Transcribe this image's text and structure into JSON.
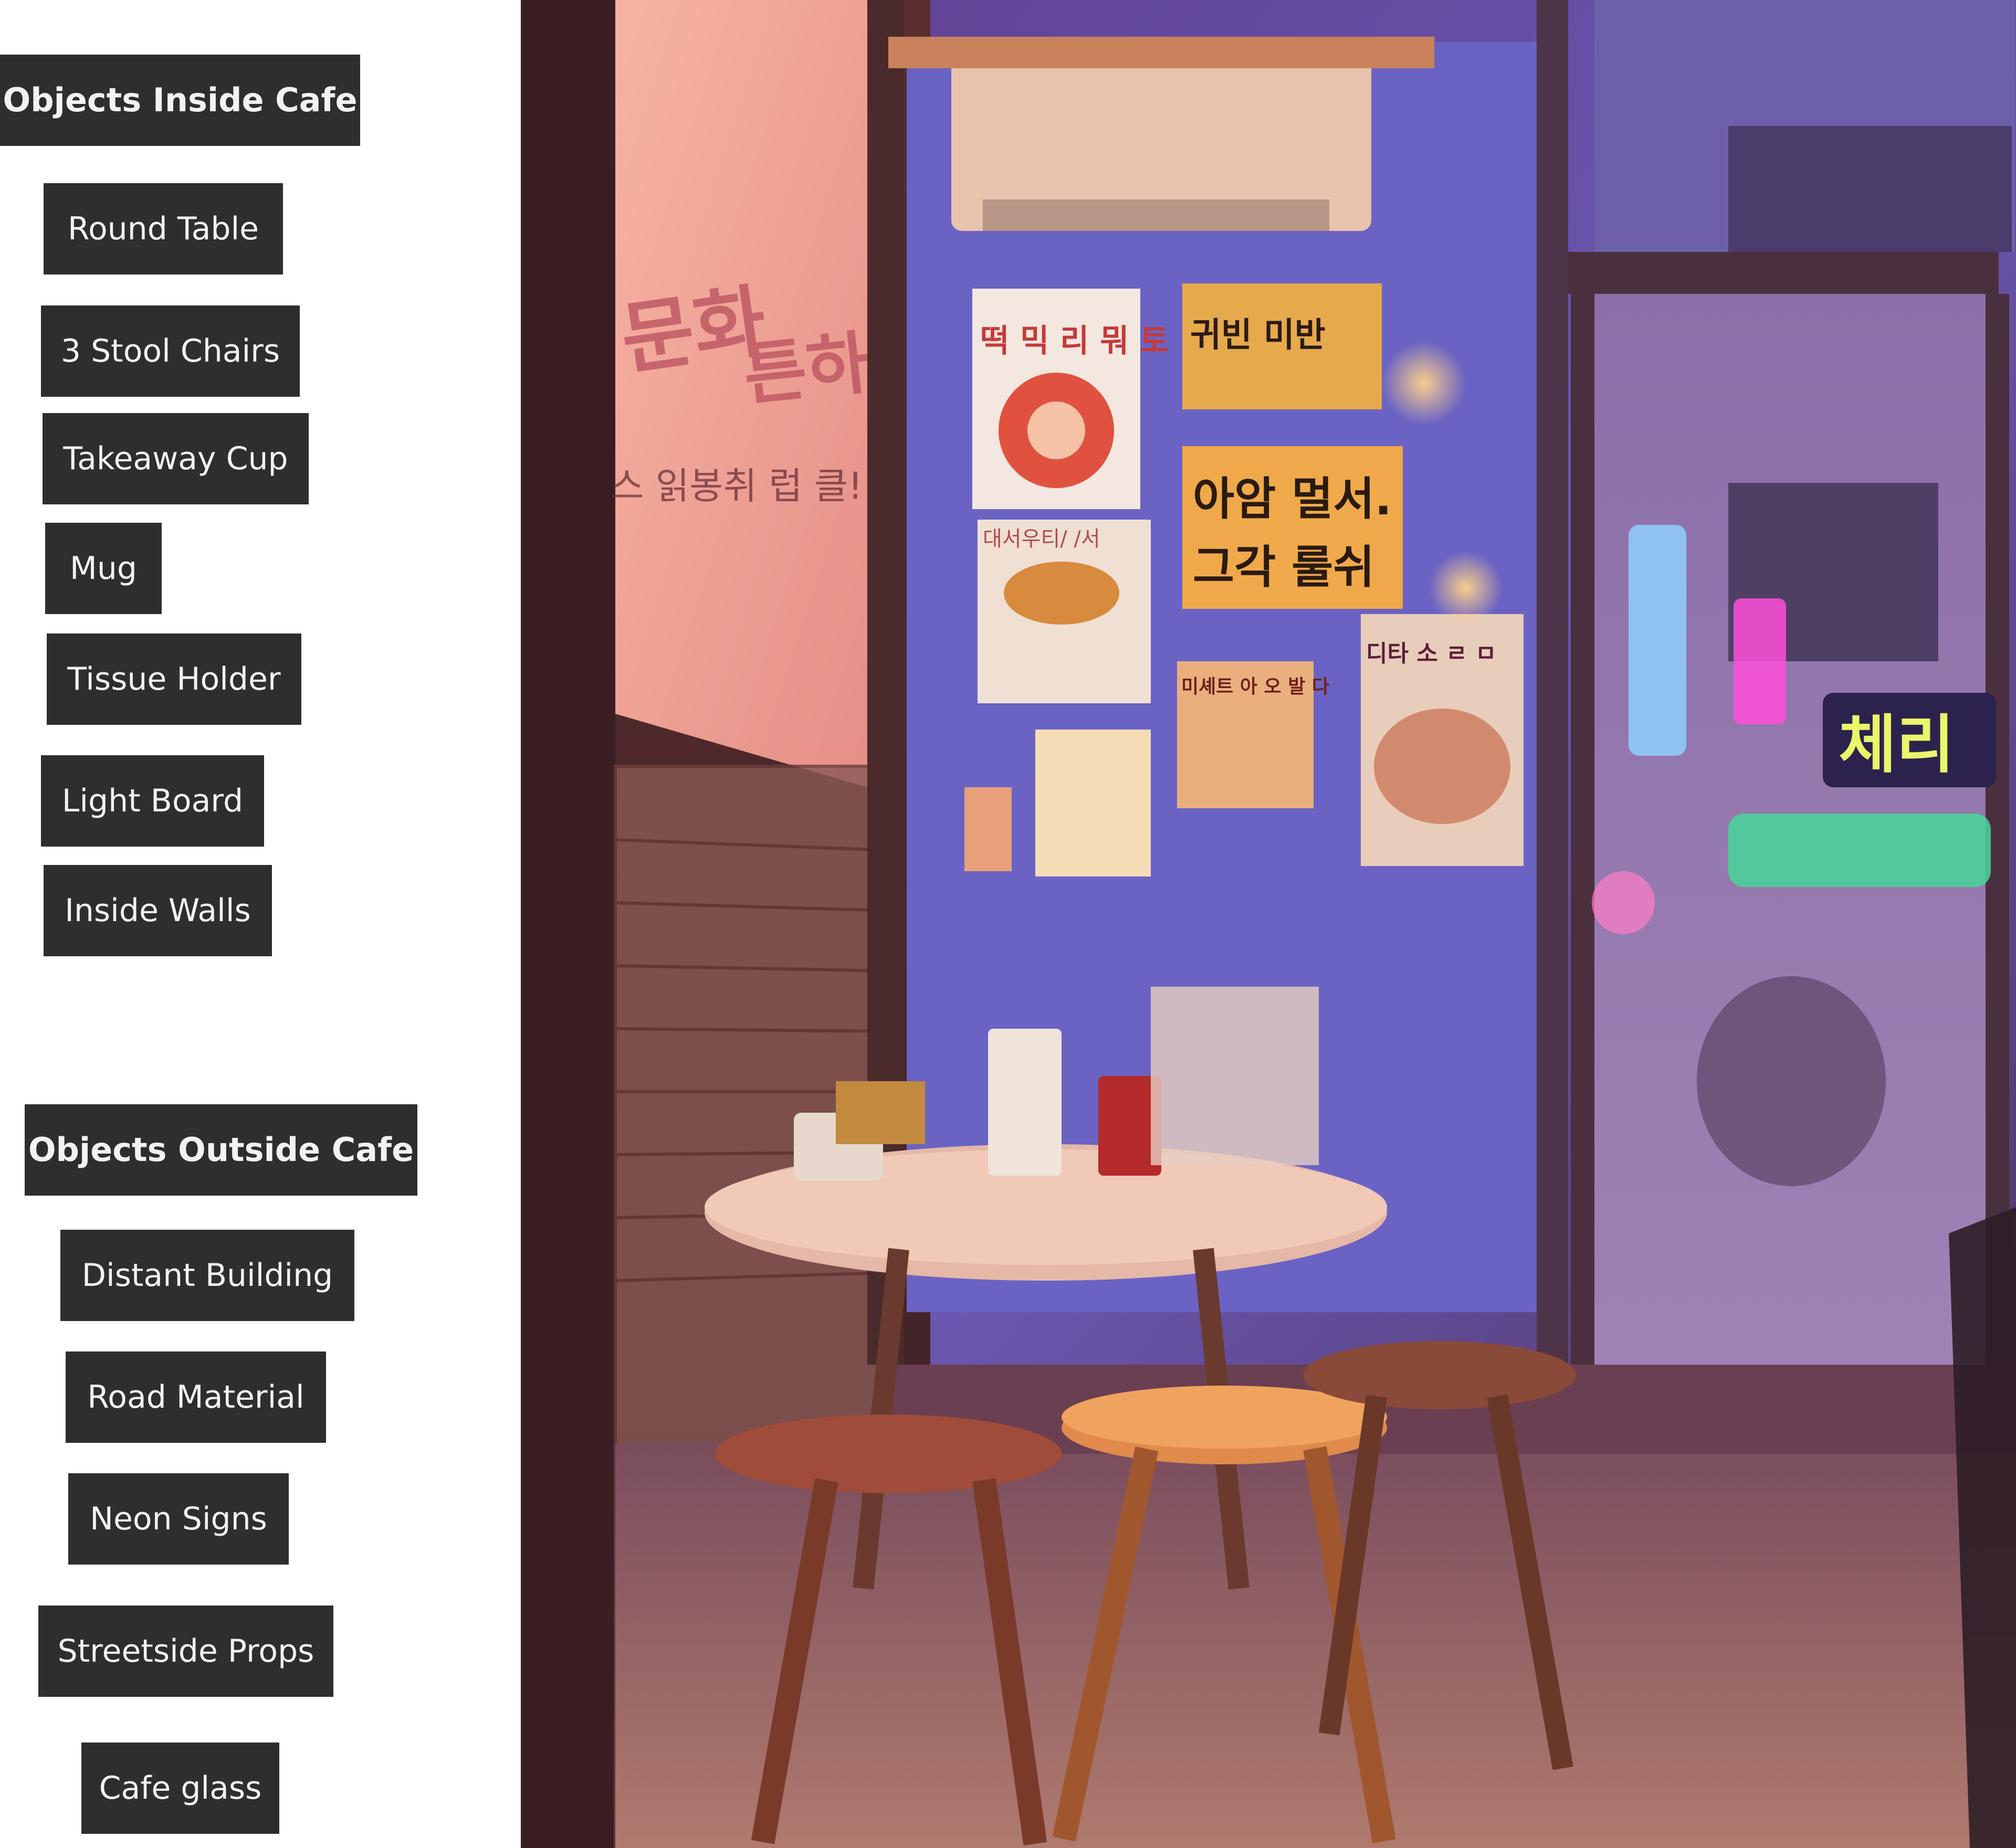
{
  "inside": {
    "header": "Objects Inside Cafe",
    "items": [
      "Round Table",
      "3 Stool Chairs",
      "Takeaway Cup",
      "Mug",
      "Tissue Holder",
      "Light Board",
      "Inside Walls"
    ]
  },
  "outside": {
    "header": "Objects Outside Cafe",
    "items": [
      "Distant Building",
      "Road Material",
      "Neon Signs",
      "Streetside Props",
      "Cafe glass"
    ]
  },
  "scene": {
    "subject": "cafe-interior-night-photo",
    "poster_1": "떡 믹 리 뭐 토",
    "poster_2": "귀빈 미반",
    "poster_3_line1": "아암 멀서.",
    "poster_3_line2": "그각 룰쉬",
    "poster_4": "대서우티/ /서",
    "poster_5": "미셰트 아 오 발 다",
    "poster_6": "디타 소 ㄹ ㅁ",
    "neon_sign": "체리"
  },
  "colors": {
    "tag_bg": "#2e2e2e",
    "tag_text": "#f2f2f2"
  }
}
